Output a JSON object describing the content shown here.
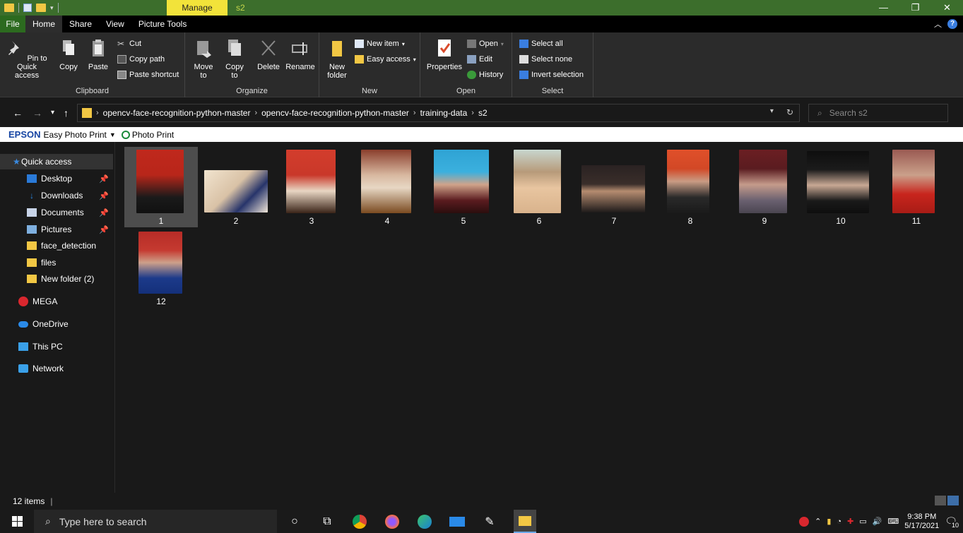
{
  "window": {
    "context_tab": "Manage",
    "title": "s2",
    "controls": {
      "minimize": "—",
      "maximize": "❐",
      "close": "✕"
    }
  },
  "tabs": [
    "File",
    "Home",
    "Share",
    "View",
    "Picture Tools"
  ],
  "ribbon": {
    "clipboard": {
      "label": "Clipboard",
      "pin": "Pin to Quick access",
      "copy": "Copy",
      "paste": "Paste",
      "cut": "Cut",
      "copy_path": "Copy path",
      "paste_shortcut": "Paste shortcut"
    },
    "organize": {
      "label": "Organize",
      "move_to": "Move to",
      "copy_to": "Copy to",
      "delete": "Delete",
      "rename": "Rename"
    },
    "new": {
      "label": "New",
      "new_folder": "New folder",
      "new_item": "New item",
      "easy_access": "Easy access"
    },
    "open": {
      "label": "Open",
      "properties": "Properties",
      "open": "Open",
      "edit": "Edit",
      "history": "History"
    },
    "select": {
      "label": "Select",
      "select_all": "Select all",
      "select_none": "Select none",
      "invert": "Invert selection"
    }
  },
  "address": {
    "crumbs": [
      "opencv-face-recognition-python-master",
      "opencv-face-recognition-python-master",
      "training-data",
      "s2"
    ],
    "search_placeholder": "Search s2"
  },
  "epson_bar": {
    "brand": "EPSON",
    "app": "Easy Photo Print",
    "photo_print": "Photo Print"
  },
  "sidebar": {
    "items": [
      {
        "label": "Quick access",
        "icon": "star-icon"
      },
      {
        "label": "Desktop",
        "icon": "desktop-icon"
      },
      {
        "label": "Downloads",
        "icon": "download-icon"
      },
      {
        "label": "Documents",
        "icon": "document-icon"
      },
      {
        "label": "Pictures",
        "icon": "picture-icon"
      },
      {
        "label": "face_detection",
        "icon": "folder-icon"
      },
      {
        "label": "files",
        "icon": "folder-icon"
      },
      {
        "label": "New folder (2)",
        "icon": "folder-icon"
      },
      {
        "label": "MEGA",
        "icon": "mega-icon"
      },
      {
        "label": "OneDrive",
        "icon": "cloud-icon"
      },
      {
        "label": "This PC",
        "icon": "computer-icon"
      },
      {
        "label": "Network",
        "icon": "network-icon"
      }
    ]
  },
  "files": [
    "1",
    "2",
    "3",
    "4",
    "5",
    "6",
    "7",
    "8",
    "9",
    "10",
    "11",
    "12"
  ],
  "status": {
    "count": "12 items"
  },
  "taskbar": {
    "search_placeholder": "Type here to search",
    "time": "9:38 PM",
    "date": "5/17/2021",
    "notifications": "10"
  },
  "colors": {
    "title_green": "#3c6e2c",
    "manage_yellow": "#f2e33a",
    "file_tab": "#2c6a1f",
    "bg": "#191919",
    "accent_blue": "#3a7ee0"
  }
}
